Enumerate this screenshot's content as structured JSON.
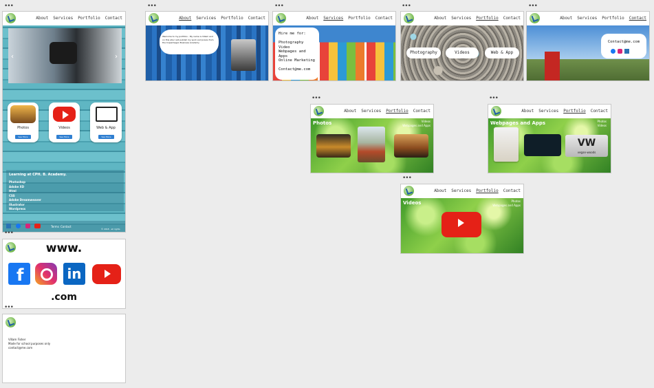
{
  "nav": {
    "about": "About",
    "services": "Services",
    "portfolio": "Portfolio",
    "contact": "Contact"
  },
  "dots": "•••",
  "home": {
    "cards": [
      {
        "label": "Photos",
        "button": "See More"
      },
      {
        "label": "Videos",
        "button": "See More"
      },
      {
        "label": "Web & App",
        "button": "See More"
      }
    ],
    "learning_title": "Learning at CPH. B. Academy.",
    "skills": [
      "Photoshop",
      "Adobe XD",
      "Html",
      "CSS",
      "Adobe Dreamweaver",
      "Illustrator",
      "Wordpress"
    ],
    "footer_links": [
      "Terms",
      "Contact"
    ],
    "copyright": "© 2018 · all rights"
  },
  "about": {
    "bubble": "Welcome to my portfolio - My name is Villam and on this site I will publish my work and praxis from the Copenhagen Business Academy"
  },
  "services": {
    "lines": [
      "Hire me for:",
      "",
      "Photography",
      "Video",
      "Webpages and Apps",
      "Online Marketing",
      "",
      "Contact@me.com"
    ]
  },
  "portfolio": {
    "pills": [
      "Photography",
      "Videos",
      "Web & App"
    ]
  },
  "contact": {
    "email": "Contact@me.com"
  },
  "social": {
    "top": "www.",
    "bottom": ".com"
  },
  "footer_page": {
    "lines": [
      "Villam Fisher",
      "Made for school purposes only",
      "contact@me.com"
    ]
  },
  "photos_page": {
    "title": "Photos",
    "links": [
      "Videos",
      "Webpages and Apps"
    ]
  },
  "web_page": {
    "title": "Webpages and Apps",
    "links": [
      "Photos",
      "Videos"
    ],
    "logo_text": "VW",
    "logo_sub": "vegan-woods"
  },
  "videos_page": {
    "title": "Videos",
    "links": [
      "Photos",
      "Webpages and Apps"
    ]
  }
}
